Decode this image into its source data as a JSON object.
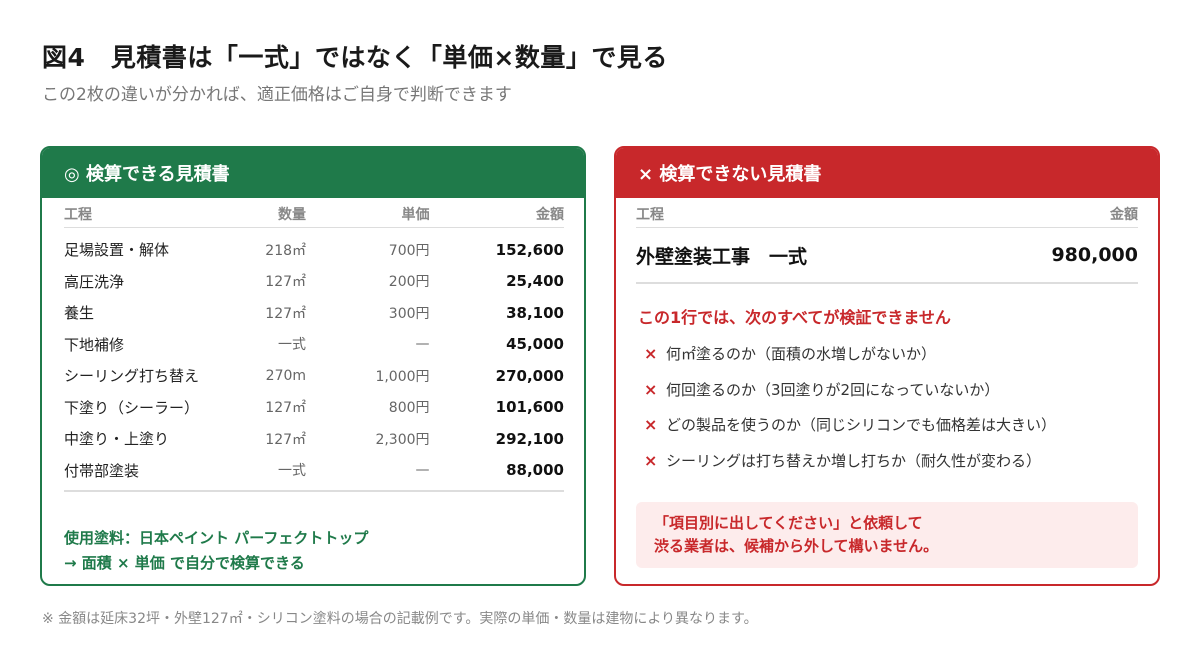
{
  "header": {
    "title": "図4　見積書は「一式」ではなく「単価×数量」で見る",
    "subtitle": "この2枚の違いが分かれば、適正価格はご自身で判断できます"
  },
  "good_card": {
    "title": "◎ 検算できる見積書",
    "columns": [
      "工程",
      "数量",
      "単価",
      "金額"
    ],
    "rows": [
      {
        "item": "足場設置・解体",
        "qty": "218㎡",
        "unit": "700円",
        "amount": "152,600"
      },
      {
        "item": "高圧洗浄",
        "qty": "127㎡",
        "unit": "200円",
        "amount": "25,400"
      },
      {
        "item": "養生",
        "qty": "127㎡",
        "unit": "300円",
        "amount": "38,100"
      },
      {
        "item": "下地補修",
        "qty": "一式",
        "unit": "—",
        "amount": "45,000"
      },
      {
        "item": "シーリング打ち替え",
        "qty": "270m",
        "unit": "1,000円",
        "amount": "270,000"
      },
      {
        "item": "下塗り（シーラー）",
        "qty": "127㎡",
        "unit": "800円",
        "amount": "101,600"
      },
      {
        "item": "中塗り・上塗り",
        "qty": "127㎡",
        "unit": "2,300円",
        "amount": "292,100"
      },
      {
        "item": "付帯部塗装",
        "qty": "一式",
        "unit": "—",
        "amount": "88,000"
      }
    ],
    "footer_line1": "使用塗料：日本ペイント パーフェクトトップ",
    "footer_line2": "→ 面積 × 単価 で自分で検算できる",
    "color": "#1f7a4a"
  },
  "bad_card": {
    "title": "× 検算できない見積書",
    "columns": [
      "工程",
      "金額"
    ],
    "row": {
      "item": "外壁塗装工事　一式",
      "amount": "980,000"
    },
    "warning_title": "この1行では、次のすべてが検証できません",
    "warnings": [
      "何㎡塗るのか（面積の水増しがないか）",
      "何回塗るのか（3回塗りが2回になっていないか）",
      "どの製品を使うのか（同じシリコンでも価格差は大きい）",
      "シーリングは打ち替えか増し打ちか（耐久性が変わる）"
    ],
    "warning_mark": "×",
    "notice_line1": "「項目別に出してください」と依頼して",
    "notice_line2": "渋る業者は、候補から外して構いません。",
    "color": "#c8282b"
  },
  "footnote": "※ 金額は延床32坪・外壁127㎡・シリコン塗料の場合の記載例です。実際の単価・数量は建物により異なります。"
}
